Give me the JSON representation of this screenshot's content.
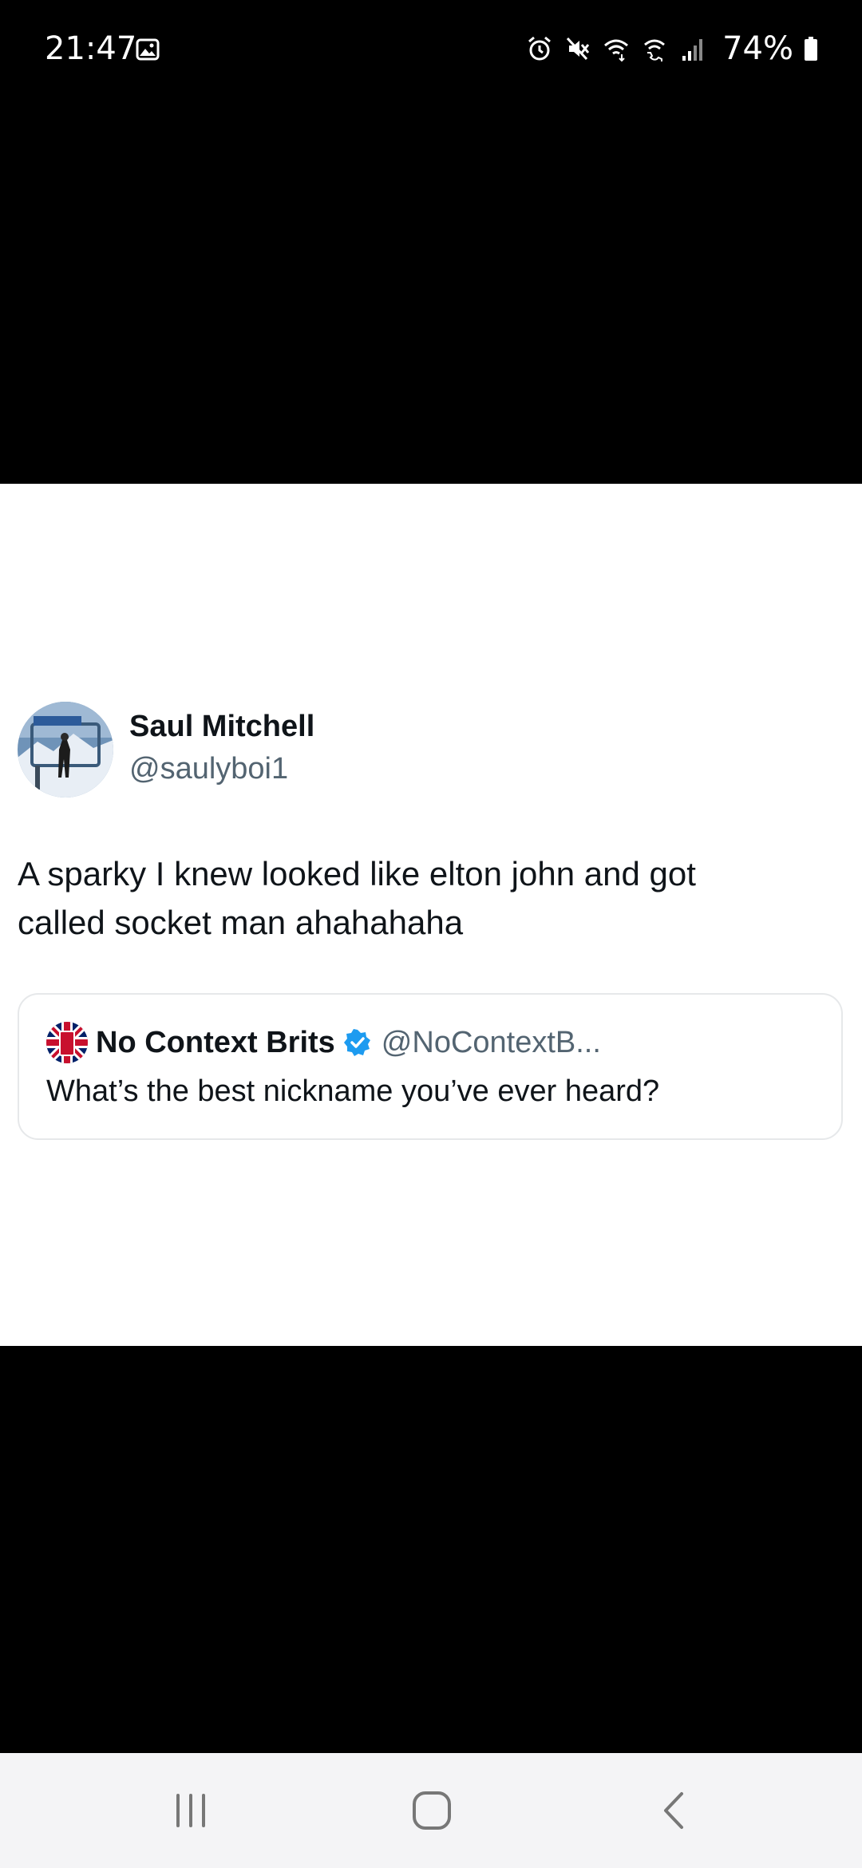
{
  "status_bar": {
    "time": "21:47",
    "battery_text": "74%",
    "icons": [
      "gallery-icon",
      "alarm-icon",
      "mute-icon",
      "wifi-icon",
      "wifi-call-icon",
      "signal-icon",
      "battery-icon"
    ]
  },
  "tweet": {
    "author_name": "Saul Mitchell",
    "author_handle": "@saulyboi1",
    "text_line1": "A sparky I knew looked like elton john and got",
    "text_line2": "called socket man ahahahaha",
    "quote": {
      "author_name": "No Context Brits",
      "author_handle": "@NoContextB...",
      "text": "What’s the best nickname you’ve ever heard?",
      "verified": true
    }
  },
  "nav_bar": {
    "buttons": [
      "recents-button",
      "home-button",
      "back-button"
    ]
  },
  "colors": {
    "background": "#000000",
    "card": "#ffffff",
    "text_primary": "#0f1419",
    "text_secondary": "#536471",
    "verified": "#1d9bf0",
    "nav_bar": "#f4f4f6"
  }
}
